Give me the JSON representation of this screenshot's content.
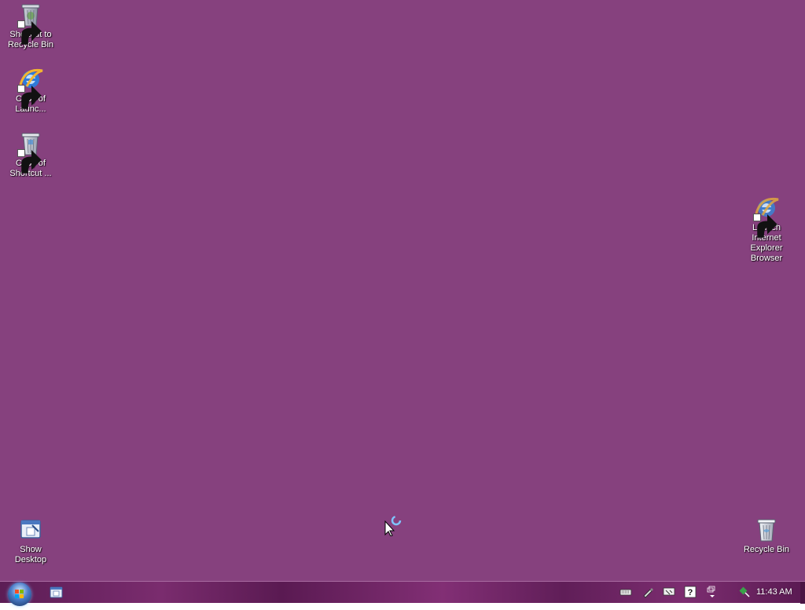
{
  "desktop": {
    "background_color": "#86417e",
    "icons": [
      {
        "name": "Shortcut to Recycle Bin",
        "label_line1": "Shortcut to",
        "label_line2": "Recycle Bin",
        "icon": "recycle-bin-icon",
        "shortcut": true
      },
      {
        "name": "Copy of Launch Internet Explorer",
        "label_line1": "Copy of",
        "label_line2": "Launc...",
        "icon": "internet-explorer-icon",
        "shortcut": true
      },
      {
        "name": "Copy of Shortcut to Recycle Bin",
        "label_line1": "Copy of",
        "label_line2": "Shortcut ...",
        "icon": "recycle-bin-icon",
        "shortcut": true
      },
      {
        "name": "Launch Internet Explorer Browser",
        "label_line1": "Launch",
        "label_line2": "Internet",
        "label_line3": "Explorer",
        "label_line4": "Browser",
        "icon": "internet-explorer-icon",
        "shortcut": true
      },
      {
        "name": "Show Desktop",
        "label_line1": "Show",
        "label_line2": "Desktop",
        "icon": "show-desktop-icon",
        "shortcut": false
      },
      {
        "name": "Recycle Bin",
        "label_line1": "Recycle Bin",
        "icon": "recycle-bin-icon",
        "shortcut": false
      }
    ]
  },
  "taskbar": {
    "start_button": "start-orb-icon",
    "quick_launch": [
      "show-desktop-icon"
    ],
    "tray_icons": [
      "keyboard-icon",
      "pen-icon",
      "network-icon",
      "help-icon",
      "window-restore-icon",
      "network-status-icon"
    ],
    "clock": "11:43 AM"
  },
  "cursor": "busy-pointer-icon"
}
